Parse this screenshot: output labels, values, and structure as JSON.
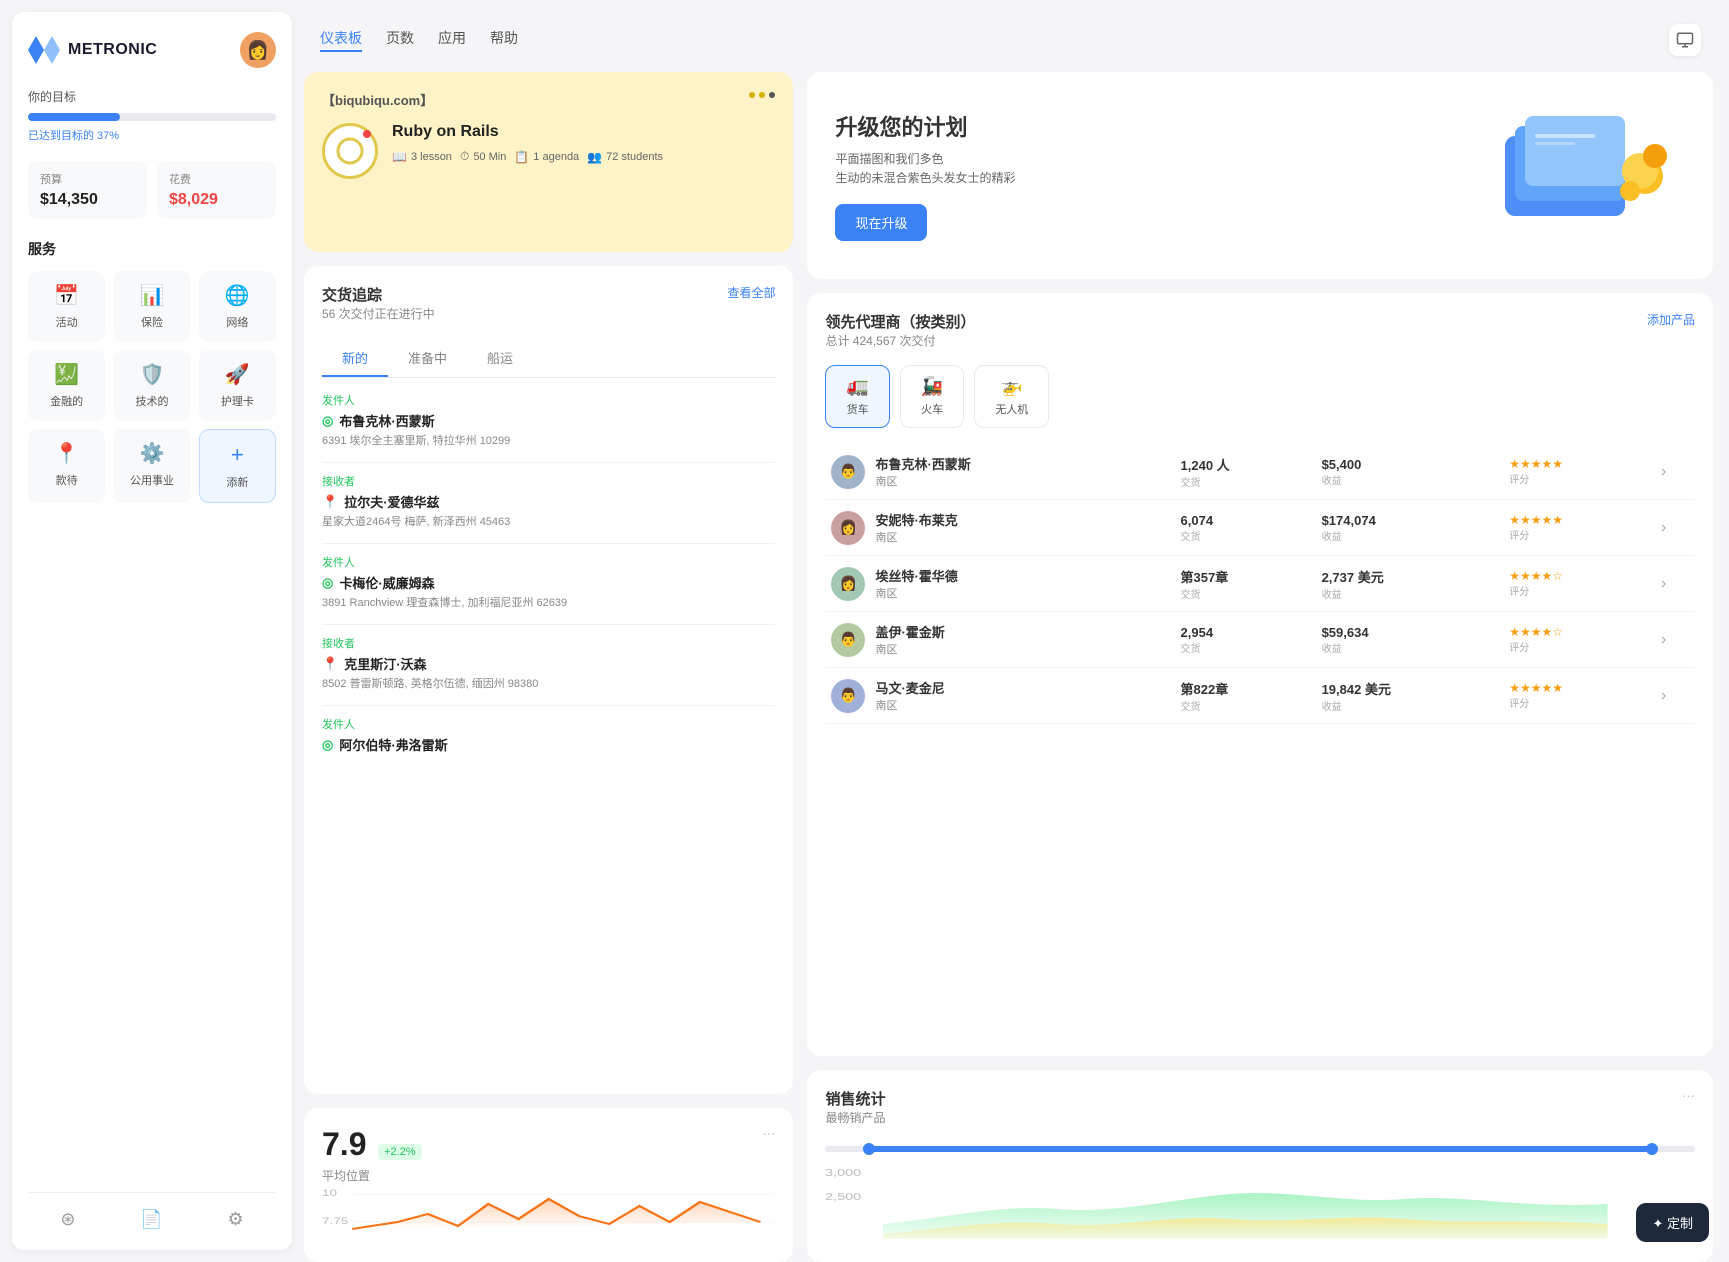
{
  "sidebar": {
    "logo_text": "METRONIC",
    "goal_label": "你的目标",
    "progress_pct": 37,
    "progress_text": "已达到目标的 37%",
    "budget": {
      "label": "预算",
      "value": "$14,350"
    },
    "expense": {
      "label": "花费",
      "value": "$8,029"
    },
    "services_title": "服务",
    "services": [
      {
        "id": "activity",
        "label": "活动",
        "icon": "📅"
      },
      {
        "id": "insurance",
        "label": "保险",
        "icon": "📊"
      },
      {
        "id": "network",
        "label": "网络",
        "icon": "🌐"
      },
      {
        "id": "financial",
        "label": "金融的",
        "icon": "💹"
      },
      {
        "id": "technical",
        "label": "技术的",
        "icon": "🛡️"
      },
      {
        "id": "nursing",
        "label": "护理卡",
        "icon": "🚀"
      },
      {
        "id": "reception",
        "label": "款待",
        "icon": "📍"
      },
      {
        "id": "public",
        "label": "公用事业",
        "icon": "⚙️"
      },
      {
        "id": "add",
        "label": "添新",
        "icon": "+"
      }
    ],
    "footer_icons": [
      "layers",
      "file",
      "settings"
    ]
  },
  "topnav": {
    "links": [
      {
        "label": "仪表板",
        "active": true
      },
      {
        "label": "页数",
        "active": false
      },
      {
        "label": "应用",
        "active": false
      },
      {
        "label": "帮助",
        "active": false
      }
    ]
  },
  "course_card": {
    "site": "【biqubiqu.com】",
    "title": "Ruby on Rails",
    "lessons": "3 lesson",
    "duration": "50 Min",
    "agenda": "1 agenda",
    "students": "72 students",
    "dot1_active": false,
    "dot2_active": true
  },
  "upgrade_card": {
    "title": "升级您的计划",
    "desc_line1": "平面描图和我们多色",
    "desc_line2": "生动的未混合紫色头发女士的精彩",
    "btn_label": "现在升级"
  },
  "shipment": {
    "title": "交货追踪",
    "subtitle": "56 次交付正在进行中",
    "view_all": "查看全部",
    "tabs": [
      "新的",
      "准备中",
      "船运"
    ],
    "active_tab": 0,
    "entries": [
      {
        "role": "发件人",
        "name": "布鲁克林·西蒙斯",
        "address": "6391 埃尔全主塞里斯, 特拉华州 10299",
        "loc_type": "green"
      },
      {
        "role": "接收者",
        "name": "拉尔夫·爱德华兹",
        "address": "星家大道2464号 梅萨, 新泽西州 45463",
        "loc_type": "purple"
      },
      {
        "role": "发件人",
        "name": "卡梅伦·威廉姆森",
        "address": "3891 Ranchview 理查森博士, 加利福尼亚州 62639",
        "loc_type": "green"
      },
      {
        "role": "接收者",
        "name": "克里斯汀·沃森",
        "address": "8502 普雷斯顿路, 英格尔伍德, 缅因州 98380",
        "loc_type": "purple"
      },
      {
        "role": "发件人",
        "name": "阿尔伯特·弗洛雷斯",
        "address": "",
        "loc_type": "green"
      }
    ]
  },
  "agents": {
    "title": "领先代理商（按类别）",
    "subtitle": "总计 424,567 次交付",
    "add_btn": "添加产品",
    "categories": [
      {
        "id": "truck",
        "label": "货车",
        "icon": "🚛",
        "active": true
      },
      {
        "id": "train",
        "label": "火车",
        "icon": "🚂",
        "active": false
      },
      {
        "id": "drone",
        "label": "无人机",
        "icon": "🚁",
        "active": false
      }
    ],
    "agents_list": [
      {
        "name": "布鲁克林·西蒙斯",
        "region": "南区",
        "transactions": "1,240 人",
        "transactions_label": "交货",
        "revenue": "$5,400",
        "revenue_label": "收益",
        "stars": 5,
        "rating_label": "评分",
        "avatar_color": "#a0b4c8"
      },
      {
        "name": "安妮特·布莱克",
        "region": "南区",
        "transactions": "6,074",
        "transactions_label": "交货",
        "revenue": "$174,074",
        "revenue_label": "收益",
        "stars": 5,
        "rating_label": "评分",
        "avatar_color": "#c8a0a0"
      },
      {
        "name": "埃丝特·霍华德",
        "region": "南区",
        "transactions": "第357章",
        "transactions_label": "交货",
        "revenue": "2,737 美元",
        "revenue_label": "收益",
        "stars": 4,
        "rating_label": "评分",
        "avatar_color": "#a0c8b4"
      },
      {
        "name": "盖伊·霍金斯",
        "region": "南区",
        "transactions": "2,954",
        "transactions_label": "交货",
        "revenue": "$59,634",
        "revenue_label": "收益",
        "stars": 4,
        "rating_label": "评分",
        "avatar_color": "#b4c8a0"
      },
      {
        "name": "马文·麦金尼",
        "region": "南区",
        "transactions": "第822章",
        "transactions_label": "交货",
        "revenue": "19,842 美元",
        "revenue_label": "收益",
        "stars": 5,
        "rating_label": "评分",
        "avatar_color": "#a0b0d8"
      }
    ]
  },
  "stat_widget": {
    "value": "7.9",
    "change": "+2.2%",
    "label": "平均位置",
    "menu": "···"
  },
  "sales_stats": {
    "title": "销售统计",
    "subtitle": "最畅销产品",
    "menu": "···",
    "y_labels": [
      "10",
      "7.75"
    ],
    "x_range_left": "3,000",
    "x_range_right": "2,500"
  },
  "custom_btn": {
    "label": "✦ 定制"
  }
}
